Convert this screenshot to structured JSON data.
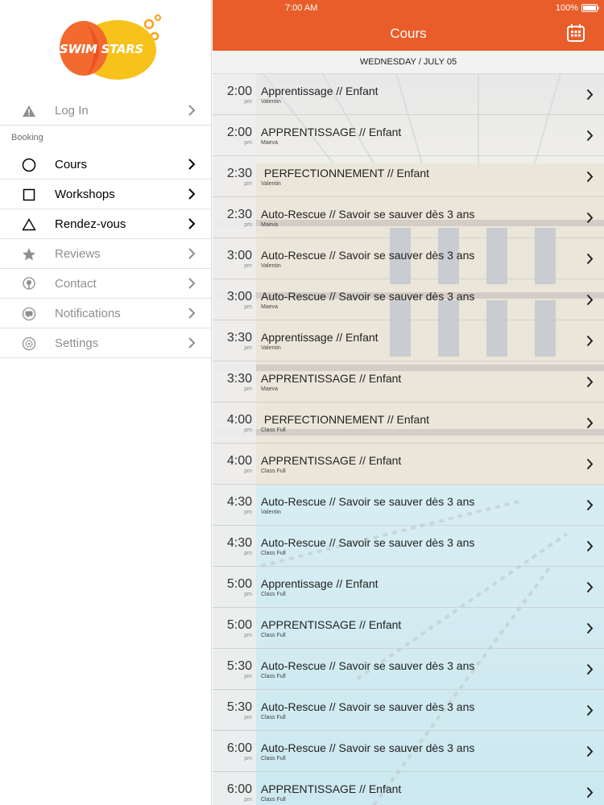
{
  "status_bar": {
    "time": "7:00 AM",
    "battery": "100%"
  },
  "brand": {
    "logo_text": "SWIM STARS"
  },
  "colors": {
    "accent": "#e85d2a",
    "logo_orange": "#f26a2e",
    "logo_yellow": "#f7c21c"
  },
  "sidebar": {
    "section_header": "Booking",
    "items": [
      {
        "label": "Log In",
        "icon": "warning-icon"
      },
      {
        "label": "Cours",
        "icon": "circle-icon"
      },
      {
        "label": "Workshops",
        "icon": "square-icon"
      },
      {
        "label": "Rendez-vous",
        "icon": "triangle-icon"
      },
      {
        "label": "Reviews",
        "icon": "star-icon"
      },
      {
        "label": "Contact",
        "icon": "location-pin-icon"
      },
      {
        "label": "Notifications",
        "icon": "chat-bubble-icon"
      },
      {
        "label": "Settings",
        "icon": "gear-icon"
      }
    ]
  },
  "header": {
    "title": "Cours",
    "calendar_icon": "calendar-icon"
  },
  "date_header": "WEDNESDAY / JULY 05",
  "classes": [
    {
      "time": "2:00",
      "meridiem": "pm",
      "title": "Apprentissage // Enfant",
      "sub": "Valentin"
    },
    {
      "time": "2:00",
      "meridiem": "pm",
      "title": "APPRENTISSAGE // Enfant",
      "sub": "Maeva"
    },
    {
      "time": "2:30",
      "meridiem": "pm",
      "title": " PERFECTIONNEMENT // Enfant",
      "sub": "Valentin"
    },
    {
      "time": "2:30",
      "meridiem": "pm",
      "title": "Auto-Rescue // Savoir se sauver dès 3 ans",
      "sub": "Maeva"
    },
    {
      "time": "3:00",
      "meridiem": "pm",
      "title": "Auto-Rescue // Savoir se sauver dès 3 ans",
      "sub": "Valentin"
    },
    {
      "time": "3:00",
      "meridiem": "pm",
      "title": "Auto-Rescue // Savoir se sauver dès 3 ans",
      "sub": "Maeva"
    },
    {
      "time": "3:30",
      "meridiem": "pm",
      "title": "Apprentissage // Enfant",
      "sub": "Valentin"
    },
    {
      "time": "3:30",
      "meridiem": "pm",
      "title": "APPRENTISSAGE // Enfant",
      "sub": "Maeva"
    },
    {
      "time": "4:00",
      "meridiem": "pm",
      "title": " PERFECTIONNEMENT // Enfant",
      "sub": "Class Full"
    },
    {
      "time": "4:00",
      "meridiem": "pm",
      "title": "APPRENTISSAGE // Enfant",
      "sub": "Class Full"
    },
    {
      "time": "4:30",
      "meridiem": "pm",
      "title": "Auto-Rescue // Savoir se sauver dès 3 ans",
      "sub": "Valentin"
    },
    {
      "time": "4:30",
      "meridiem": "pm",
      "title": "Auto-Rescue // Savoir se sauver dès 3 ans",
      "sub": "Class Full"
    },
    {
      "time": "5:00",
      "meridiem": "pm",
      "title": "Apprentissage // Enfant",
      "sub": "Class Full"
    },
    {
      "time": "5:00",
      "meridiem": "pm",
      "title": "APPRENTISSAGE // Enfant",
      "sub": "Class Full"
    },
    {
      "time": "5:30",
      "meridiem": "pm",
      "title": "Auto-Rescue // Savoir se sauver dès 3 ans",
      "sub": "Class Full"
    },
    {
      "time": "5:30",
      "meridiem": "pm",
      "title": "Auto-Rescue // Savoir se sauver dès 3 ans",
      "sub": "Class Full"
    },
    {
      "time": "6:00",
      "meridiem": "pm",
      "title": "Auto-Rescue // Savoir se sauver dès 3 ans",
      "sub": "Class Full"
    },
    {
      "time": "6:00",
      "meridiem": "pm",
      "title": "APPRENTISSAGE // Enfant",
      "sub": "Class Full"
    }
  ]
}
